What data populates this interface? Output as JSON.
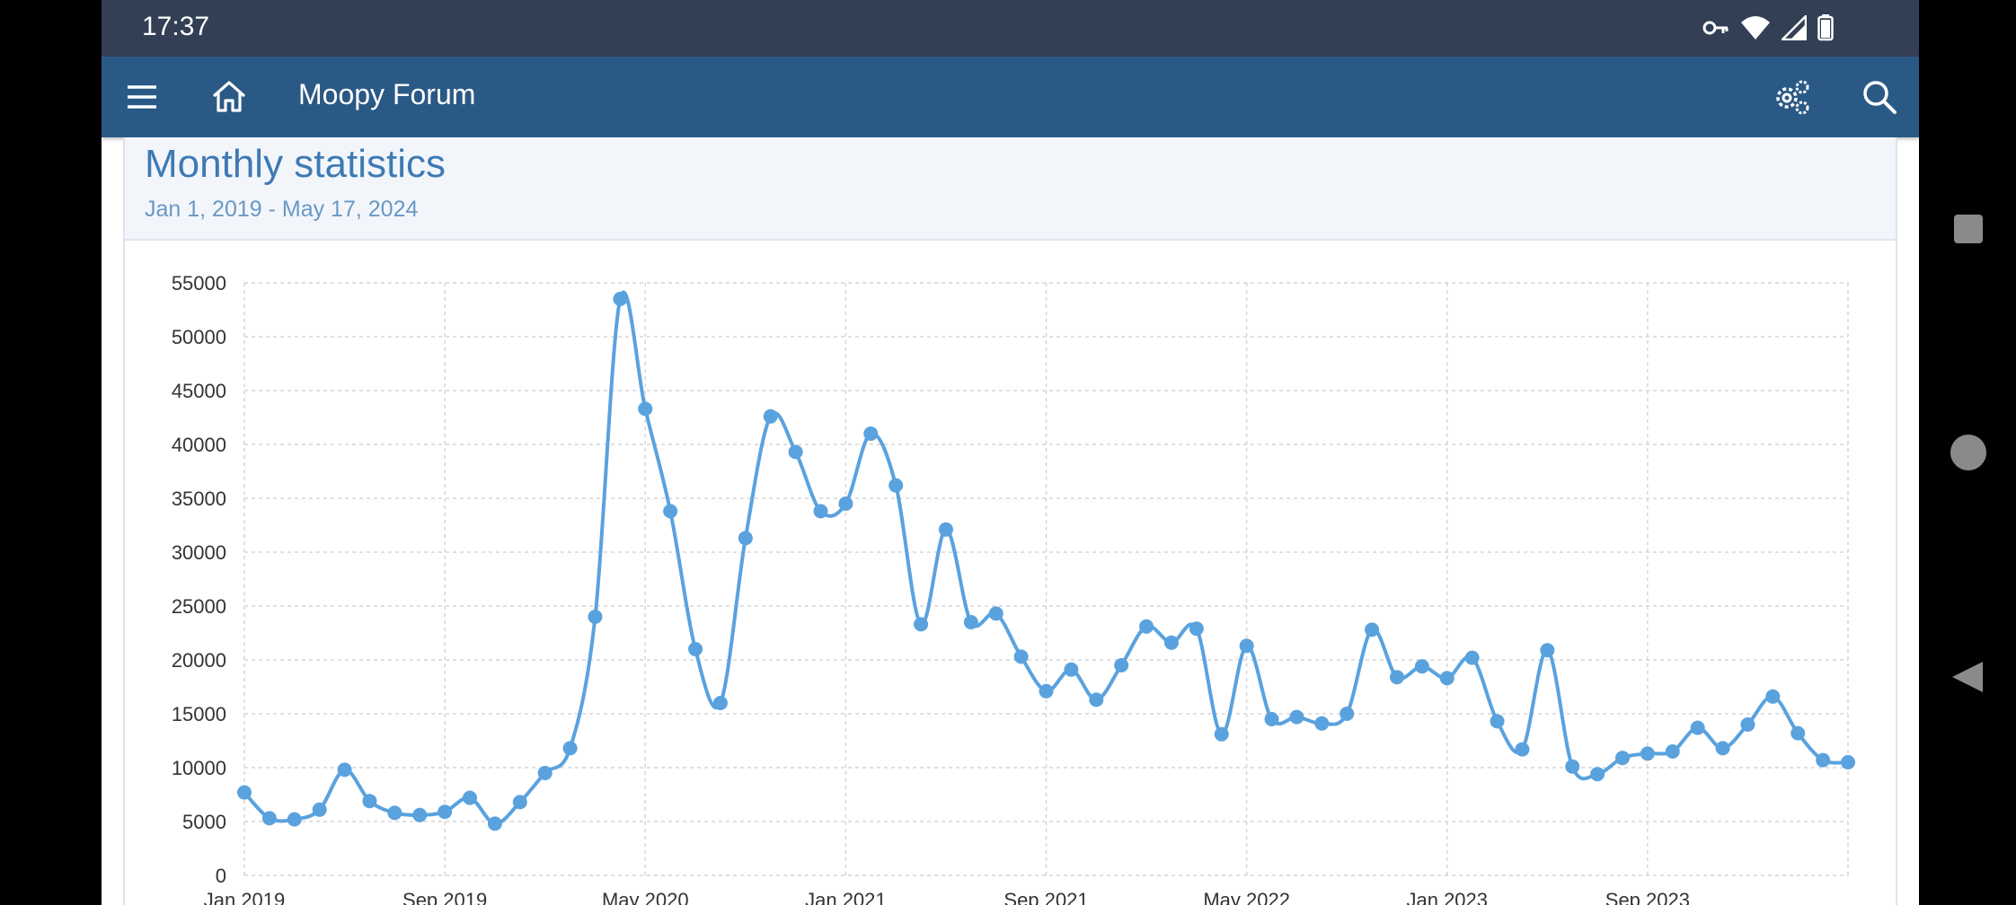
{
  "status_bar": {
    "time": "17:37",
    "icons": [
      "vpn-key-icon",
      "wifi-icon",
      "signal-icon",
      "battery-icon"
    ]
  },
  "app_bar": {
    "title": "Moopy Forum",
    "left_icons": [
      "menu-icon",
      "home-icon"
    ],
    "right_icons": [
      "settings-gears-icon",
      "search-icon"
    ],
    "background": "#2b5985"
  },
  "card": {
    "title": "Monthly statistics",
    "subtitle": "Jan 1, 2019 - May 17, 2024"
  },
  "chart_data": {
    "type": "line",
    "color": "#5aa2de",
    "ylim": [
      0,
      55000
    ],
    "y_ticks": [
      0,
      5000,
      10000,
      15000,
      20000,
      25000,
      30000,
      35000,
      40000,
      45000,
      50000,
      55000
    ],
    "x_tick_labels": [
      "Jan 2019",
      "Sep 2019",
      "May 2020",
      "Jan 2021",
      "Sep 2021",
      "May 2022",
      "Jan 2023",
      "Sep 2023"
    ],
    "x_tick_months": [
      0,
      8,
      16,
      24,
      32,
      40,
      48,
      56
    ],
    "grid": true,
    "series": [
      {
        "values": [
          7700,
          5300,
          5200,
          6100,
          9800,
          6900,
          5800,
          5600,
          5900,
          7200,
          4800,
          6800,
          9500,
          11800,
          24000,
          53500,
          43300,
          33800,
          21000,
          16000,
          31300,
          42600,
          39300,
          33800,
          34500,
          41000,
          36200,
          23300,
          32100,
          23500,
          24300,
          20300,
          17100,
          19100,
          16300,
          19500,
          23100,
          21600,
          22900,
          13100,
          21300,
          14500,
          14700,
          14100,
          15000,
          22800,
          18400,
          19400,
          18300,
          20200,
          14300,
          11700,
          20900,
          10100,
          9400,
          10900,
          11300,
          11500,
          13700,
          11800,
          14000,
          16600,
          13200,
          10700,
          10500
        ]
      }
    ]
  },
  "nav_bar": {
    "buttons": [
      "recents-square-icon",
      "home-circle-icon",
      "back-triangle-icon"
    ]
  }
}
